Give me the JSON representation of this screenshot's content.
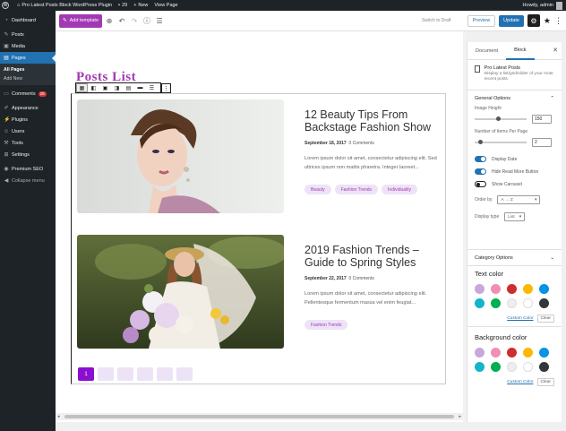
{
  "adminbar": {
    "site_name": "Pro Latest Posts Block WordPress Plugin",
    "updates_count": "29",
    "new_label": "New",
    "view_page": "View Page",
    "howdy": "Howdy, admin"
  },
  "sidebar": {
    "items": [
      {
        "label": "Dashboard",
        "icon": "dashboard-icon"
      },
      {
        "label": "Posts",
        "icon": "pin-icon"
      },
      {
        "label": "Media",
        "icon": "media-icon"
      },
      {
        "label": "Pages",
        "icon": "pages-icon"
      },
      {
        "label": "Comments",
        "icon": "comment-icon",
        "badge": "29"
      },
      {
        "label": "Appearance",
        "icon": "brush-icon"
      },
      {
        "label": "Plugins",
        "icon": "plugin-icon"
      },
      {
        "label": "Users",
        "icon": "user-icon"
      },
      {
        "label": "Tools",
        "icon": "wrench-icon"
      },
      {
        "label": "Settings",
        "icon": "settings-icon"
      },
      {
        "label": "Premium SEO",
        "icon": "seo-icon"
      },
      {
        "label": "Collapse menu",
        "icon": "collapse-icon"
      }
    ],
    "submenu": [
      "All Pages",
      "Add New"
    ]
  },
  "toolbar": {
    "add_template": "Add template",
    "switch_draft": "Switch to Draft",
    "preview": "Preview",
    "update": "Update"
  },
  "block": {
    "title": "Posts List"
  },
  "posts": [
    {
      "title": "12 Beauty Tips From Backstage Fashion Show",
      "date": "September 18, 2017",
      "comments": "0 Comments",
      "excerpt": "Lorem ipsum dolor sit amet, consectetur adipiscing elit. Sed ultrices ipsum non mattis pharetra. Integer laoreet...",
      "tags": [
        "Beauty",
        "Fashion Trends",
        "Individuality"
      ]
    },
    {
      "title": "2019 Fashion Trends – Guide to Spring Styles",
      "date": "September 22, 2017",
      "comments": "0 Comments",
      "excerpt": "Lorem ipsum dolor sit amet, consectetur adipiscing elit. Pellentesque fermentum massa vel enim feugiat...",
      "tags": [
        "Fashion Trends"
      ]
    }
  ],
  "pagination": {
    "current": "1",
    "pages": [
      "2",
      "3",
      "4",
      "5",
      "6"
    ]
  },
  "panel": {
    "tabs": [
      "Document",
      "Block"
    ],
    "block_name": "Pro Latest Posts",
    "block_desc": "Display a list/grid/slider of your most recent posts.",
    "general_options": "General Options",
    "image_height_label": "Image Height",
    "image_height_value": "150",
    "image_height_level": 0.45,
    "items_per_page_label": "Number of Items Per Page",
    "items_per_page_value": "2",
    "items_per_page_level": 0.12,
    "toggles": [
      {
        "label": "Display Date",
        "on": true
      },
      {
        "label": "Hide Read More Button",
        "on": true
      },
      {
        "label": "Show Carousel",
        "on": false
      }
    ],
    "order_by_label": "Order by",
    "order_by_value": "A → Z",
    "display_type_label": "Display type",
    "display_type_value": "List",
    "category_options": "Category Options",
    "text_color": "Text color",
    "background_color": "Background color",
    "custom_color": "Custom Color",
    "clear": "Clear",
    "swatches": [
      "#c9a6dc",
      "#f08fb4",
      "#cf2e2e",
      "#fcb900",
      "#0693e3",
      "#13b5c8",
      "#00b050",
      "#eeeeee",
      "#ffffff",
      "#32373c"
    ]
  }
}
